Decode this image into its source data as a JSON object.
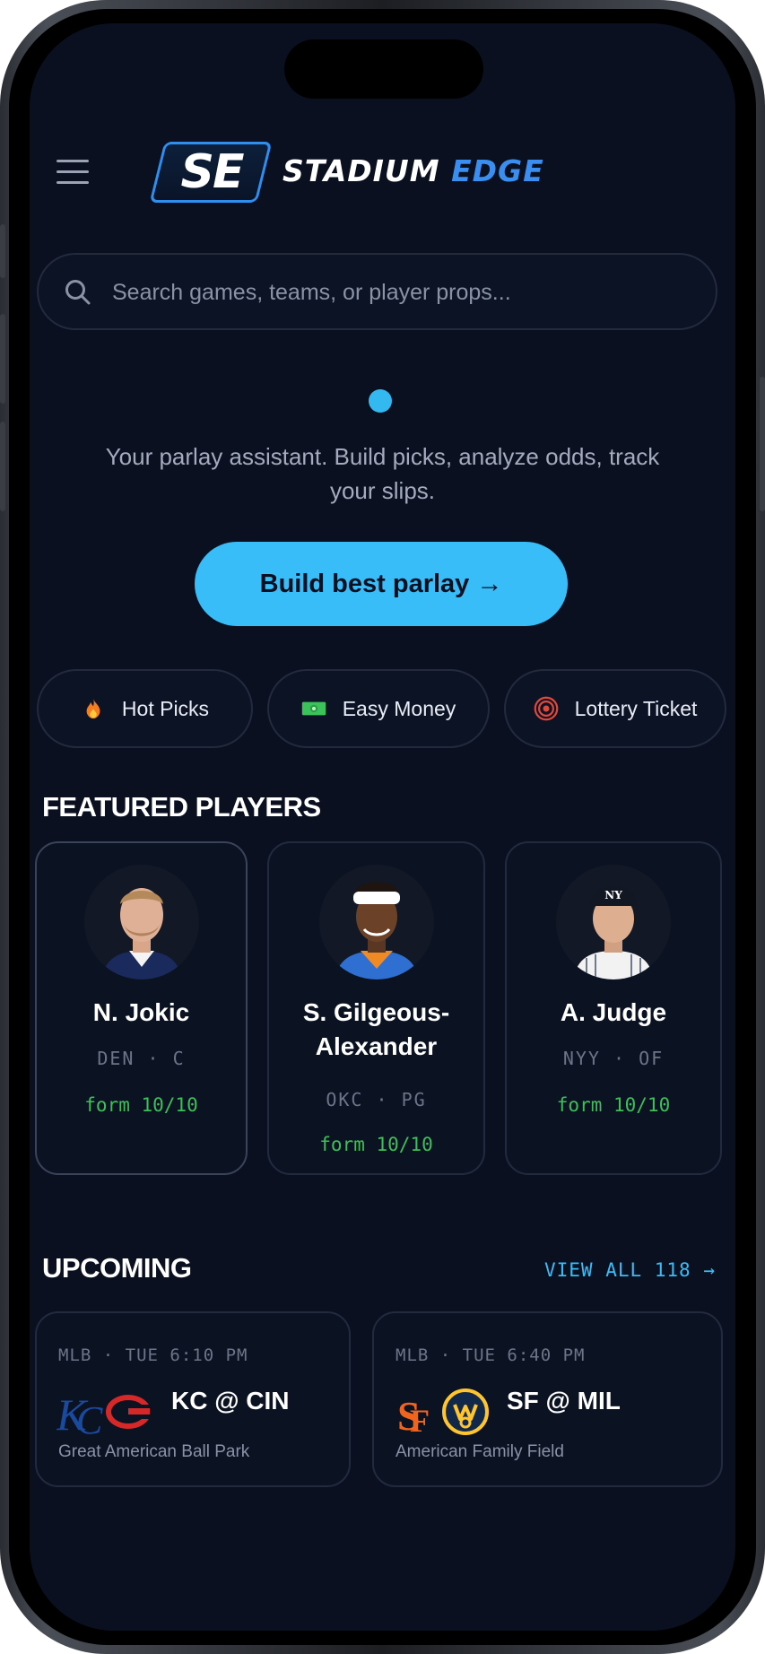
{
  "brand": {
    "badge": "SE",
    "word1": "STADIUM",
    "word2": "EDGE"
  },
  "search": {
    "placeholder": "Search games, teams, or player props..."
  },
  "tagline": "Your parlay assistant. Build picks, analyze odds, track your slips.",
  "cta": {
    "label": "Build best parlay →"
  },
  "chips": [
    {
      "label": "Hot Picks",
      "icon": "fire-icon"
    },
    {
      "label": "Easy Money",
      "icon": "cash-icon"
    },
    {
      "label": "Lottery Ticket",
      "icon": "target-icon"
    }
  ],
  "featured": {
    "title": "FEATURED PLAYERS",
    "players": [
      {
        "name": "N. Jokic",
        "team": "DEN",
        "pos": "C",
        "meta": "DEN · C",
        "form": "form 10/10"
      },
      {
        "name": "S. Gilgeous-Alexander",
        "team": "OKC",
        "pos": "PG",
        "meta": "OKC · PG",
        "form": "form 10/10"
      },
      {
        "name": "A. Judge",
        "team": "NYY",
        "pos": "OF",
        "meta": "NYY · OF",
        "form": "form 10/10"
      }
    ]
  },
  "upcoming": {
    "title": "UPCOMING",
    "view_all": "VIEW ALL 118 →",
    "games": [
      {
        "meta": "MLB · TUE 6:10 PM",
        "matchup": "KC @ CIN",
        "venue": "Great American Ball Park",
        "away_logo": "kc-royals-logo",
        "home_logo": "cin-reds-logo"
      },
      {
        "meta": "MLB · TUE 6:40 PM",
        "matchup": "SF @ MIL",
        "venue": "American Family Field",
        "away_logo": "sf-giants-logo",
        "home_logo": "mil-brewers-logo"
      }
    ]
  },
  "colors": {
    "accent": "#38bdf8",
    "background": "#0a1020",
    "form_green": "#3fbf5a",
    "brand_blue": "#2f8ff0"
  }
}
